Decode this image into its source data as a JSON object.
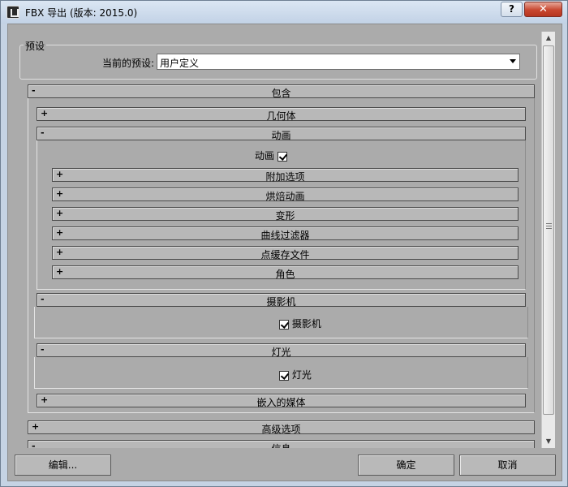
{
  "window": {
    "title": "FBX 导出 (版本: 2015.0)",
    "help_label": "?",
    "close_label": "✕"
  },
  "presets": {
    "group_title": "预设",
    "current_label": "当前的预设:",
    "current_value": "用户定义"
  },
  "rollouts": {
    "include": {
      "toggle": "-",
      "title": "包含"
    },
    "geometry": {
      "toggle": "+",
      "title": "几何体"
    },
    "animation": {
      "toggle": "-",
      "title": "动画"
    },
    "animation_checkbox": {
      "label": "动画",
      "checked": true
    },
    "extra_options": {
      "toggle": "+",
      "title": "附加选项"
    },
    "bake_animation": {
      "toggle": "+",
      "title": "烘焙动画"
    },
    "deformations": {
      "toggle": "+",
      "title": "变形"
    },
    "curve_filters": {
      "toggle": "+",
      "title": "曲线过滤器"
    },
    "point_cache": {
      "toggle": "+",
      "title": "点缓存文件"
    },
    "character": {
      "toggle": "+",
      "title": "角色"
    },
    "cameras": {
      "toggle": "-",
      "title": "摄影机"
    },
    "cameras_checkbox": {
      "label": "摄影机",
      "checked": true
    },
    "lights": {
      "toggle": "-",
      "title": "灯光"
    },
    "lights_checkbox": {
      "label": "灯光",
      "checked": true
    },
    "embed_media": {
      "toggle": "+",
      "title": "嵌入的媒体"
    },
    "advanced": {
      "toggle": "+",
      "title": "高级选项"
    },
    "info": {
      "toggle": "-",
      "title": "信息"
    }
  },
  "buttons": {
    "edit": "编辑...",
    "ok": "确定",
    "cancel": "取消"
  },
  "scrollbar": {
    "up_glyph": "▲",
    "down_glyph": "▼"
  }
}
